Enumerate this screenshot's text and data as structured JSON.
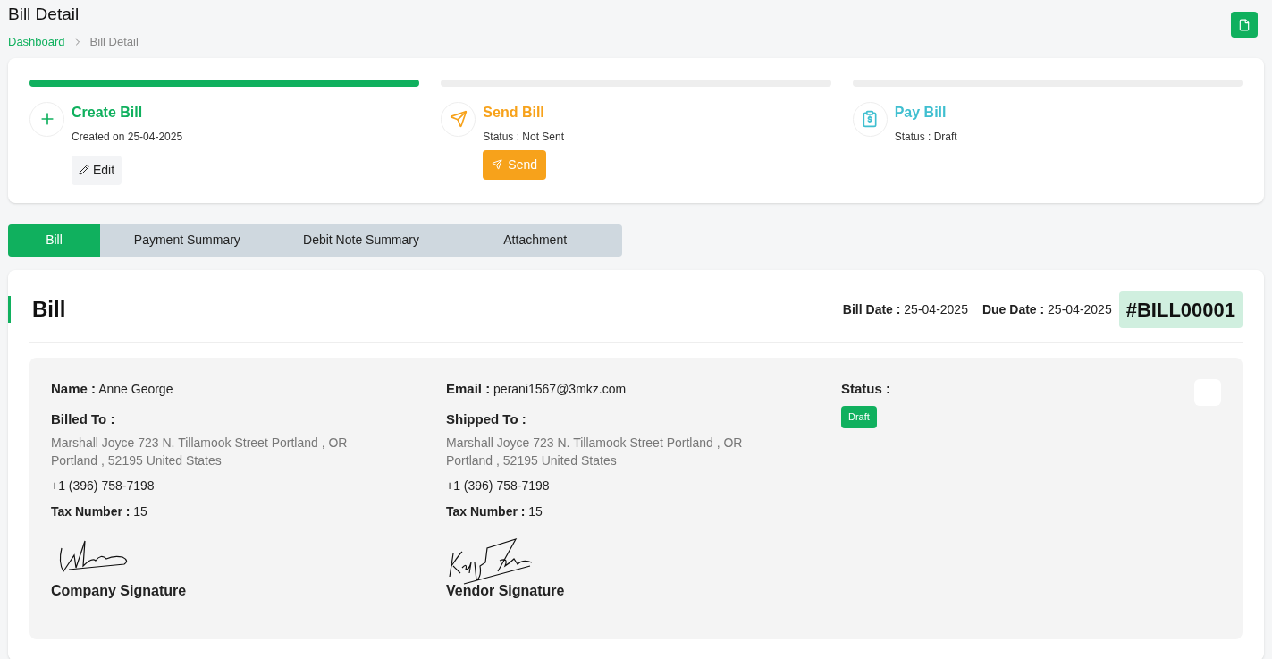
{
  "page": {
    "title": "Bill Detail"
  },
  "breadcrumb": [
    {
      "label": "Dashboard",
      "selected": false
    },
    {
      "label": "Bill Detail",
      "selected": true
    }
  ],
  "steps": [
    {
      "kind": "create",
      "title": "Create Bill",
      "subtitle": "Created on 25-04-2025",
      "level": 1,
      "action": {
        "kind": "edit",
        "label": "Edit"
      }
    },
    {
      "kind": "send",
      "title": "Send Bill",
      "subtitle": "Status : Not Sent",
      "level": 0,
      "action": {
        "kind": "send",
        "label": "Send"
      }
    },
    {
      "kind": "pay",
      "title": "Pay Bill",
      "subtitle": "Status : Draft",
      "level": 0
    }
  ],
  "tabs": [
    {
      "label": "Bill",
      "selected": true
    },
    {
      "label": "Payment Summary",
      "selected": false
    },
    {
      "label": "Debit Note Summary",
      "selected": false
    },
    {
      "label": "Attachment",
      "selected": false
    }
  ],
  "bill": {
    "title": "Bill",
    "bill_date_label": "Bill Date :",
    "bill_date": "25-04-2025",
    "due_date_label": "Due Date :",
    "due_date": "25-04-2025",
    "number": "#BILL00001",
    "parties": [
      {
        "contact_label": "Name :",
        "contact_value": "Anne George",
        "address_label": "Billed To :",
        "address": "Marshall Joyce 723 N. Tillamook Street Portland , OR Portland , 52195 United States",
        "phone": "+1 (396) 758-7198",
        "tax_label": "Tax Number :",
        "tax_value": "15",
        "kind": "company",
        "signature_label": "Company Signature"
      },
      {
        "contact_label": "Email :",
        "contact_value": "perani1567@3mkz.com",
        "address_label": "Shipped To :",
        "address": "Marshall Joyce 723 N. Tillamook Street Portland , OR Portland , 52195 United States",
        "phone": "+1 (396) 758-7198",
        "tax_label": "Tax Number :",
        "tax_value": "15",
        "kind": "vendor",
        "signature_label": "Vendor Signature"
      }
    ],
    "status_label": "Status :",
    "status": "Draft"
  }
}
